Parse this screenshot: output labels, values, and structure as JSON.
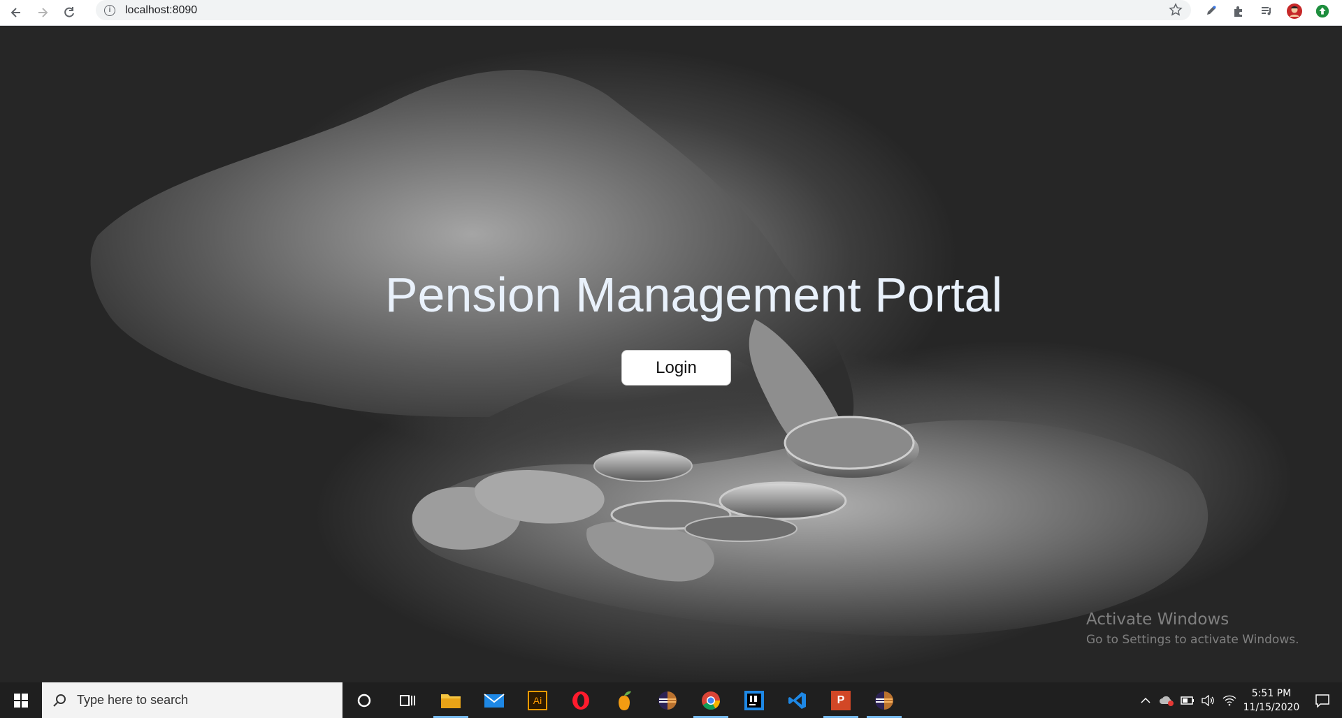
{
  "browser": {
    "url": "localhost:8090"
  },
  "hero": {
    "title": "Pension Management Portal",
    "login_label": "Login"
  },
  "watermark": {
    "line1": "Activate Windows",
    "line2": "Go to Settings to activate Windows."
  },
  "taskbar": {
    "search_placeholder": "Type here to search",
    "apps": [
      "file-explorer",
      "mail",
      "illustrator",
      "opera",
      "fruity-loops",
      "eclipse",
      "chrome",
      "intellij",
      "vscode",
      "powerpoint",
      "eclipse-2"
    ],
    "app_ai_label": "Ai",
    "app_ppt_label": "P",
    "clock": {
      "time": "5:51 PM",
      "date": "11/15/2020"
    }
  },
  "colors": {
    "accent": "#76b9ed",
    "title_text": "#e9f1fb",
    "taskbar_bg": "#1f1f1f"
  }
}
